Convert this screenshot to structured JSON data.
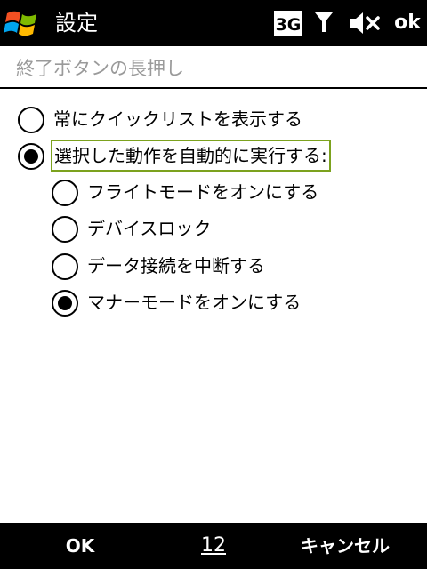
{
  "titlebar": {
    "start_icon": "windows-flag-icon",
    "title": "設定",
    "status_icons": [
      "3g-icon",
      "signal-antenna-icon",
      "volume-muted-icon"
    ],
    "network_label": "3G",
    "ok_label": "ok"
  },
  "section": {
    "heading": "終了ボタンの長押し"
  },
  "options": [
    {
      "label": "常にクイックリストを表示する",
      "selected": false
    },
    {
      "label": "選択した動作を自動的に実行する:",
      "selected": true,
      "focused": true
    },
    {
      "label": "フライトモードをオンにする",
      "selected": false
    },
    {
      "label": "デバイスロック",
      "selected": false
    },
    {
      "label": "データ接続を中断する",
      "selected": false
    },
    {
      "label": "マナーモードをオンにする",
      "selected": true
    }
  ],
  "softkeys": {
    "left": "OK",
    "middle": "12",
    "right": "キャンセル"
  },
  "colors": {
    "bars": "#000000",
    "heading_text": "#9a9a9a",
    "focus_border": "#7ca21e",
    "flag_red": "#f25022",
    "flag_green": "#7fba00",
    "flag_blue": "#00a4ef",
    "flag_yellow": "#ffb900"
  }
}
